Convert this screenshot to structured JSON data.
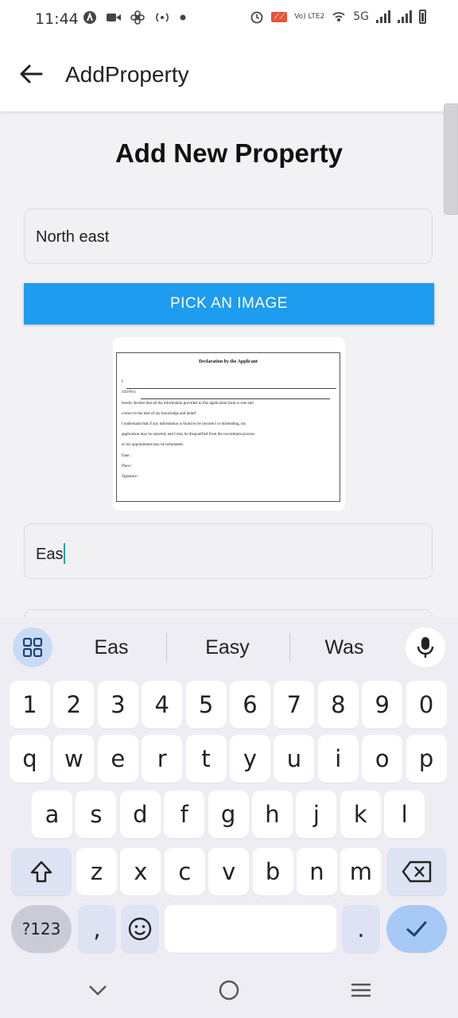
{
  "status_bar": {
    "time": "11:44",
    "network": "5G",
    "volte": "Vo) LTE2",
    "icons": [
      "a-icon",
      "video-icon",
      "fan-icon",
      "hotspot-icon",
      "dot-icon",
      "alarm-icon",
      "cast-icon",
      "volte-icon",
      "wifi-calling-icon",
      "signal-icon",
      "signal-icon",
      "battery-icon"
    ]
  },
  "app_bar": {
    "title": "AddProperty",
    "back_icon": "arrow-left-icon"
  },
  "form": {
    "heading": "Add New Property",
    "field1_value": "North east",
    "pick_image_label": "PICK AN IMAGE",
    "field2_value": "Eas",
    "accent_color": "#1e9cf0"
  },
  "document_image": {
    "title": "Declaration by the Applicant",
    "lines": [
      "I",
      "S/D/W/o",
      "hereby declare that all the information provided in this application form is true and",
      "correct to the best of my knowledge and belief.",
      "I understand that if any information is found to be incorrect or misleading, my",
      "application may be rejected, and I may be disqualified from the recruitment process",
      "or my appointment may be terminated.",
      "Date :",
      "Place :",
      "Signature :"
    ]
  },
  "keyboard": {
    "suggestions": [
      "Eas",
      "Easy",
      "Was"
    ],
    "row_numbers": [
      "1",
      "2",
      "3",
      "4",
      "5",
      "6",
      "7",
      "8",
      "9",
      "0"
    ],
    "row_q": [
      "q",
      "w",
      "e",
      "r",
      "t",
      "y",
      "u",
      "i",
      "o",
      "p"
    ],
    "row_a": [
      "a",
      "s",
      "d",
      "f",
      "g",
      "h",
      "j",
      "k",
      "l"
    ],
    "row_z": [
      "z",
      "x",
      "c",
      "v",
      "b",
      "n",
      "m"
    ],
    "symbols_label": "?123",
    "comma_label": ",",
    "emoji_label": "☺",
    "period_label": "."
  },
  "nav_bar": {
    "icons": [
      "chevron-down-icon",
      "home-circle-icon",
      "menu-icon"
    ]
  }
}
